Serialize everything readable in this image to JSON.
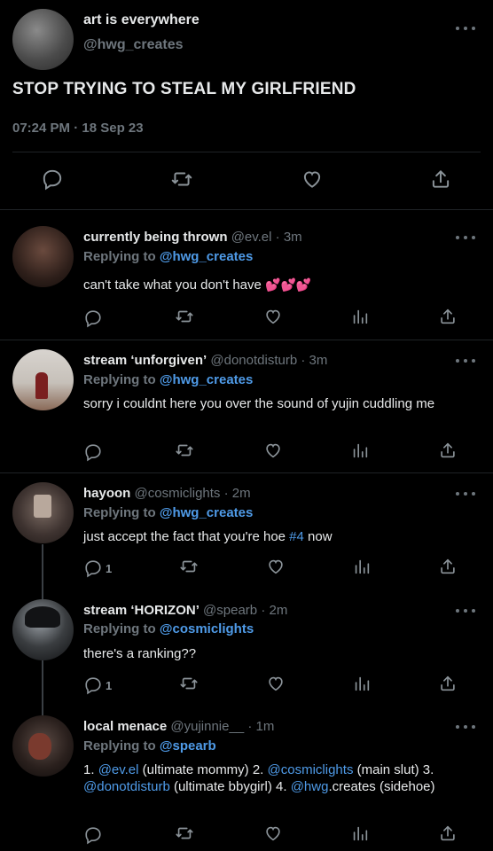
{
  "main_tweet": {
    "display_name": "art is everywhere",
    "handle": "@hwg_creates",
    "text": "STOP TRYING TO STEAL MY GIRLFRIEND",
    "time": "07:24 PM",
    "dot": "·",
    "date": "18 Sep 23"
  },
  "replies": [
    {
      "name": "currently being thrown",
      "handle": "@ev.el",
      "sep": "·",
      "time": "3m",
      "replying_label": "Replying to",
      "replying_to": "@hwg_creates",
      "text": "can't take what you don't have",
      "emoji": "💕💕💕",
      "reply_count": ""
    },
    {
      "name": "stream ‘unforgiven’",
      "handle": "@donotdisturb",
      "sep": "·",
      "time": "3m",
      "replying_label": "Replying to",
      "replying_to": "@hwg_creates",
      "text": "sorry i couldnt here you over the sound of yujin cuddling me",
      "reply_count": ""
    },
    {
      "name": "hayoon",
      "handle": "@cosmiclights",
      "sep": "·",
      "time": "2m",
      "replying_label": "Replying to",
      "replying_to": "@hwg_creates",
      "text_before": "just accept the fact that you're hoe ",
      "hashtag": "#4",
      "text_after": " now",
      "reply_count": "1"
    },
    {
      "name": "stream ‘HORIZON’",
      "handle": "@spearb",
      "sep": "·",
      "time": "2m",
      "replying_label": "Replying to",
      "replying_to": "@cosmiclights",
      "text": "there's a ranking??",
      "reply_count": "1"
    },
    {
      "name": "local menace",
      "handle": "@yujinnie__",
      "sep": "·",
      "time": "1m",
      "replying_label": "Replying to",
      "replying_to": "@spearb",
      "ranking": {
        "p1": "1. ",
        "m1": "@ev.el",
        "p2": " (ultimate mommy) 2. ",
        "m2": "@cosmiclights",
        "p3": " (main slut) 3. ",
        "m3": "@donotdisturb",
        "p4": " (ultimate bbygirl) 4. ",
        "m4": "@hwg",
        "p5": ".creates (sidehoe)"
      },
      "reply_count": ""
    }
  ],
  "icons": [
    "more-icon",
    "reply-icon",
    "retweet-icon",
    "like-icon",
    "views-icon",
    "share-icon"
  ],
  "colors": {
    "background": "#000000",
    "link": "#4f9be8",
    "muted": "#6e767d"
  }
}
